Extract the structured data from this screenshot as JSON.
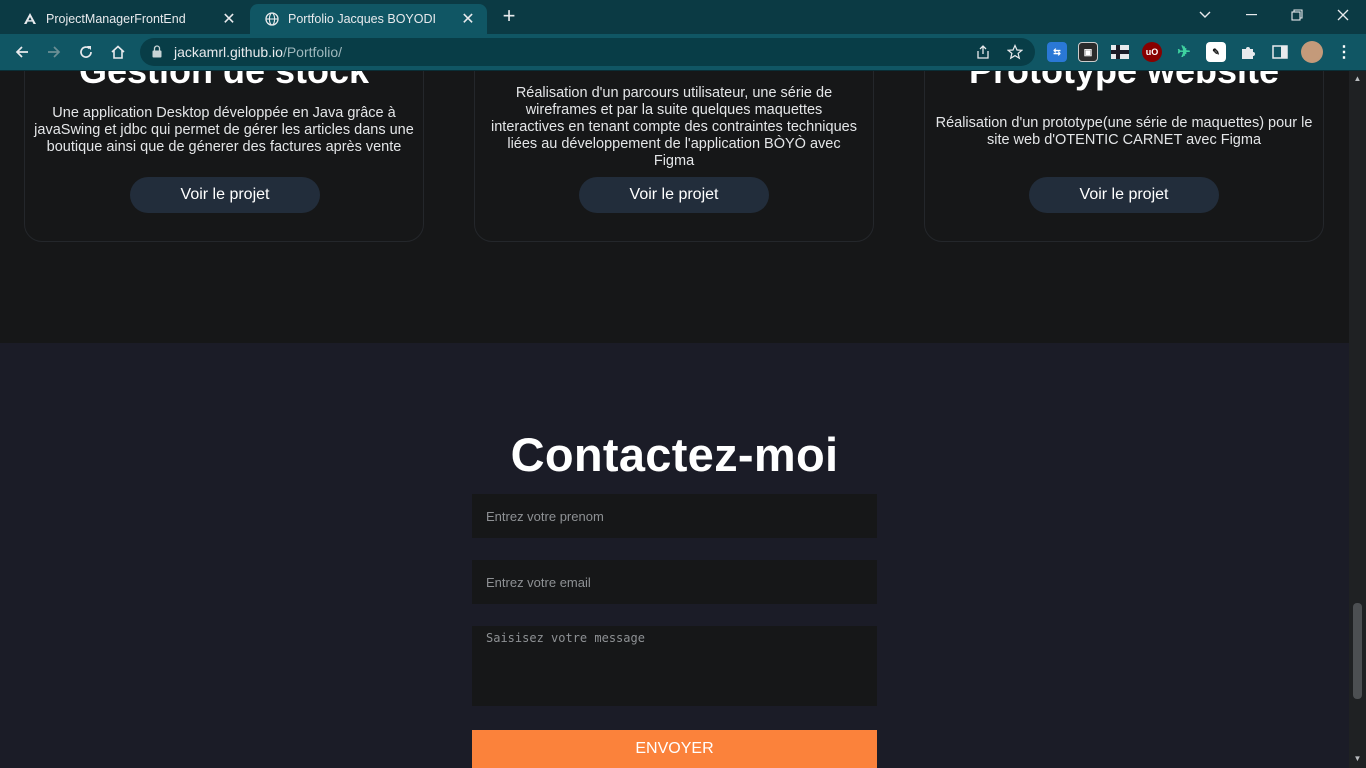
{
  "browser": {
    "tabs": [
      {
        "title": "ProjectManagerFrontEnd",
        "active": false
      },
      {
        "title": "Portfolio Jacques BOYODI",
        "active": true
      }
    ],
    "url_host": "jackamrl.github.io",
    "url_path": "/Portfolio/",
    "accent_color": "#105664"
  },
  "projects": [
    {
      "title": "Gestion de stock",
      "description": "Une application Desktop développée en Java grâce à javaSwing et jdbc qui permet de gérer les articles dans une boutique ainsi que de génerer des factures après vente",
      "button": "Voir le projet"
    },
    {
      "title": "",
      "description": "Réalisation d'un parcours utilisateur, une série de wireframes et par la suite quelques maquettes interactives en tenant compte des contraintes techniques liées au développement de l'application BÒYÒ avec Figma",
      "button": "Voir le projet"
    },
    {
      "title": "Prototype website",
      "description": "Réalisation d'un prototype(une série de maquettes) pour le site web d'OTENTIC CARNET avec Figma",
      "button": "Voir le projet"
    }
  ],
  "contact": {
    "heading": "Contactez-moi",
    "name_placeholder": "Entrez votre prenom",
    "email_placeholder": "Entrez votre email",
    "message_placeholder": "Saisisez votre message",
    "submit": "ENVOYER",
    "submit_color": "#fb823b"
  }
}
